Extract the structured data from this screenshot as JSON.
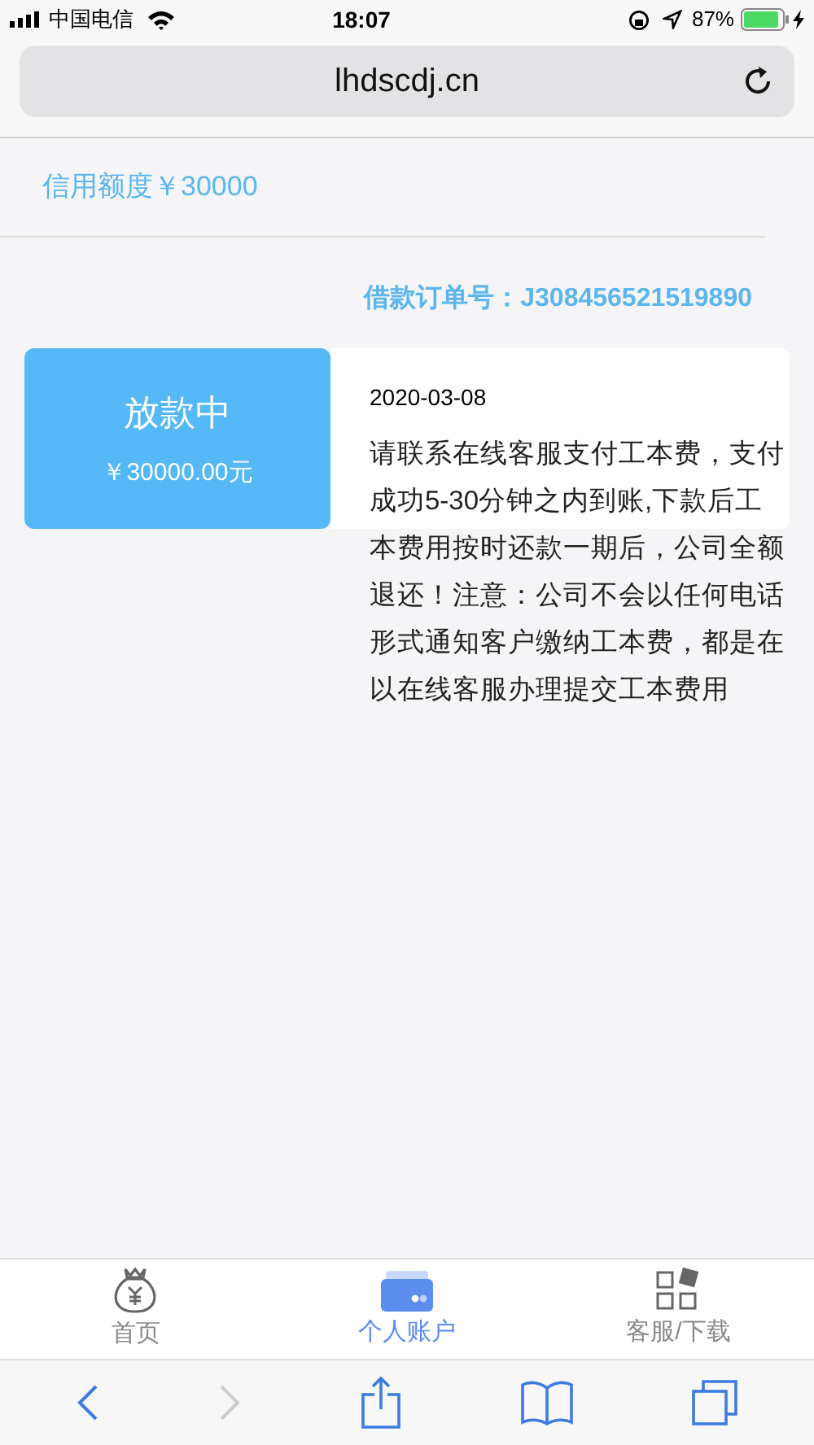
{
  "status_bar": {
    "carrier": "中国电信",
    "time": "18:07",
    "battery": "87%"
  },
  "address_bar": {
    "url": "lhdscdj.cn"
  },
  "credit_limit": "信用额度￥30000",
  "order_number": "借款订单号：J308456521519890",
  "loan": {
    "status": "放款中",
    "amount": "￥30000.00元",
    "date": "2020-03-08",
    "message": "请联系在线客服支付工本费，支付成功5-30分钟之内到账,下款后工本费用按时还款一期后，公司全额退还！注意：公司不会以任何电话形式通知客户缴纳工本费，都是在以在线客服办理提交工本费用"
  },
  "tab_bar": [
    {
      "kind": "money",
      "label": "首页",
      "selected": false
    },
    {
      "kind": "wallet",
      "label": "个人账户",
      "selected": true
    },
    {
      "kind": "grid",
      "label": "客服/下载",
      "selected": false
    }
  ],
  "toolbar": {
    "forward_disabled": true
  }
}
